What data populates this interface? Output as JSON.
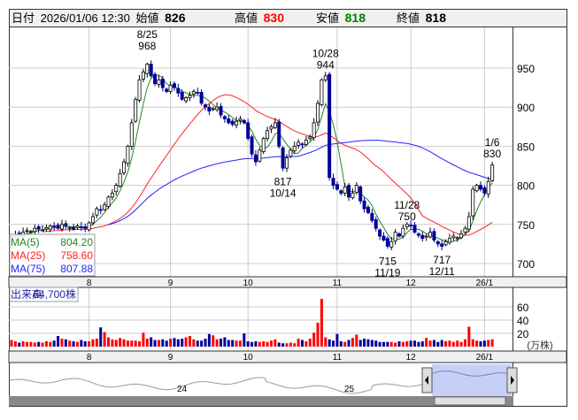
{
  "header": {
    "date_label": "日付",
    "datetime": "2026/01/06 12:30",
    "open_label": "始値",
    "open": "826",
    "high_label": "高値",
    "high": "830",
    "low_label": "安値",
    "low": "818",
    "close_label": "終値",
    "close": "818"
  },
  "legend": {
    "ma5_label": "MA(5)",
    "ma5": "804.20",
    "ma25_label": "MA(25)",
    "ma25": "758.60",
    "ma75_label": "MA(75)",
    "ma75": "807.88"
  },
  "volume_panel": {
    "label": "出来高",
    "value": "64,700株",
    "unit": "(万株)"
  },
  "navigator": {
    "labels": [
      "24",
      "25"
    ]
  },
  "colors": {
    "up_volume": "#ff0000",
    "down": "#000099",
    "ma5": "#228822",
    "ma25": "#ff2222",
    "ma75": "#2222ff",
    "high": "#ff0000",
    "low": "#008000"
  },
  "chart_data": {
    "type": "candlestick",
    "price_axis": {
      "ticks": [
        700,
        750,
        800,
        850,
        900,
        950
      ],
      "range": [
        680,
        1000
      ]
    },
    "volume_axis": {
      "ticks": [
        20,
        40,
        60
      ],
      "unit": "万株",
      "range": [
        0,
        75
      ]
    },
    "month_ticks": [
      {
        "label": "8",
        "index": 20
      },
      {
        "label": "9",
        "index": 41
      },
      {
        "label": "10",
        "index": 61
      },
      {
        "label": "11",
        "index": 84
      },
      {
        "label": "12",
        "index": 103
      },
      {
        "label": "26/1",
        "index": 122
      }
    ],
    "close": [
      735,
      737,
      736,
      740,
      742,
      741,
      745,
      744,
      743,
      746,
      748,
      747,
      745,
      750,
      748,
      746,
      744,
      748,
      746,
      745,
      752,
      760,
      770,
      768,
      775,
      785,
      790,
      800,
      815,
      830,
      850,
      880,
      910,
      935,
      945,
      955,
      940,
      930,
      935,
      925,
      920,
      928,
      925,
      918,
      910,
      912,
      915,
      920,
      918,
      905,
      900,
      895,
      898,
      900,
      890,
      885,
      880,
      878,
      882,
      885,
      880,
      860,
      840,
      830,
      845,
      860,
      870,
      875,
      880,
      850,
      822,
      835,
      845,
      850,
      855,
      852,
      858,
      862,
      880,
      905,
      935,
      940,
      810,
      800,
      795,
      790,
      798,
      785,
      790,
      800,
      780,
      770,
      765,
      755,
      745,
      735,
      730,
      722,
      728,
      740,
      735,
      745,
      750,
      748,
      740,
      736,
      732,
      735,
      740,
      730,
      725,
      722,
      728,
      732,
      735,
      733,
      738,
      745,
      760,
      795,
      800,
      795,
      790,
      805,
      826
    ],
    "volume": [
      10,
      8,
      6,
      8,
      7,
      7,
      6,
      7,
      6,
      8,
      7,
      9,
      16,
      12,
      11,
      9,
      8,
      7,
      10,
      8,
      8,
      11,
      12,
      29,
      22,
      14,
      11,
      10,
      13,
      11,
      9,
      9,
      9,
      8,
      21,
      12,
      14,
      10,
      10,
      11,
      9,
      12,
      13,
      11,
      12,
      14,
      16,
      11,
      9,
      9,
      12,
      19,
      17,
      11,
      12,
      14,
      10,
      10,
      9,
      9,
      20,
      8,
      7,
      8,
      7,
      8,
      7,
      9,
      11,
      6,
      5,
      5,
      6,
      5,
      12,
      10,
      8,
      12,
      21,
      36,
      72,
      14,
      11,
      9,
      19,
      8,
      7,
      10,
      13,
      18,
      10,
      12,
      11,
      10,
      9,
      7,
      7,
      7,
      7,
      6,
      8,
      7,
      8,
      9,
      9,
      7,
      8,
      13,
      9,
      10,
      7,
      10,
      8,
      9,
      7,
      9,
      7,
      11,
      30,
      11,
      9,
      8,
      9,
      10,
      11,
      12,
      6
    ],
    "annotations": [
      {
        "date": "8/25",
        "value": "968",
        "index": 35,
        "price": 968,
        "pos": "above"
      },
      {
        "date": "10/14",
        "value": "817",
        "index": 70,
        "price": 817,
        "pos": "below"
      },
      {
        "date": "10/28",
        "value": "944",
        "index": 81,
        "price": 944,
        "pos": "above"
      },
      {
        "date": "11/19",
        "value": "715",
        "index": 97,
        "price": 715,
        "pos": "below"
      },
      {
        "date": "11/28",
        "value": "750",
        "index": 102,
        "price": 750,
        "pos": "above"
      },
      {
        "date": "12/11",
        "value": "717",
        "index": 111,
        "price": 717,
        "pos": "below"
      },
      {
        "date": "1/6",
        "value": "830",
        "index": 124,
        "price": 830,
        "pos": "above"
      }
    ]
  }
}
